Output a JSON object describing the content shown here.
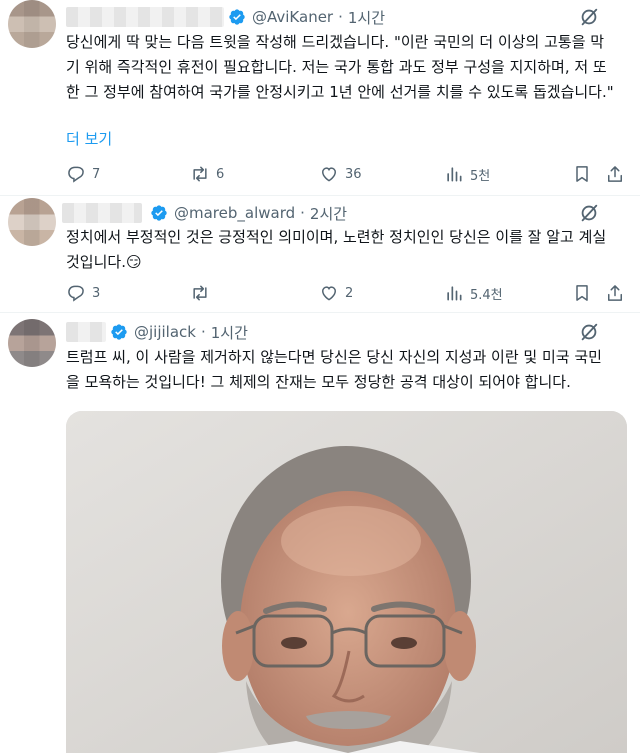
{
  "posts": [
    {
      "handle": "@AviKaner",
      "time": "1시간",
      "text": "당신에게 딱 맞는 다음 트윗을 작성해 드리겠습니다. \"이란 국민의 더 이상의 고통을 막기 위해 즉각적인 휴전이 필요합니다. 저는 국가 통합 과도 정부 구성을 지지하며, 저 또한 그 정부에 참여하여 국가를 안정시키고 1년 안에 선거를 치를 수 있도록 돕겠습니다.\"",
      "show_more": "더 보기",
      "replies": "7",
      "reposts": "6",
      "likes": "36",
      "views": "5천"
    },
    {
      "handle": "@mareb_alward",
      "time": "2시간",
      "text": "정치에서 부정적인 것은 긍정적인 의미이며, 노련한 정치인인 당신은 이를 잘 알고 계실 것입니다.😏",
      "replies": "3",
      "reposts": "",
      "likes": "2",
      "views": "5.4천"
    },
    {
      "handle": "@jijilack",
      "time": "1시간",
      "text": "트럼프 씨, 이 사람을 제거하지 않는다면 당신은 당신 자신의 지성과 이란 및 미국 국민을 모욕하는 것입니다! 그 체제의 잔재는 모두 정당한 공격 대상이 되어야 합니다."
    }
  ],
  "separator": "·",
  "icons": {
    "verified": "verified-badge-icon",
    "grok": "grok-icon",
    "reply": "reply-icon",
    "repost": "repost-icon",
    "like": "like-icon",
    "views": "views-icon",
    "bookmark": "bookmark-icon",
    "share": "share-icon"
  },
  "colors": {
    "accent": "#1d9bf0",
    "secondary_text": "#536471",
    "text": "#0f1419"
  }
}
